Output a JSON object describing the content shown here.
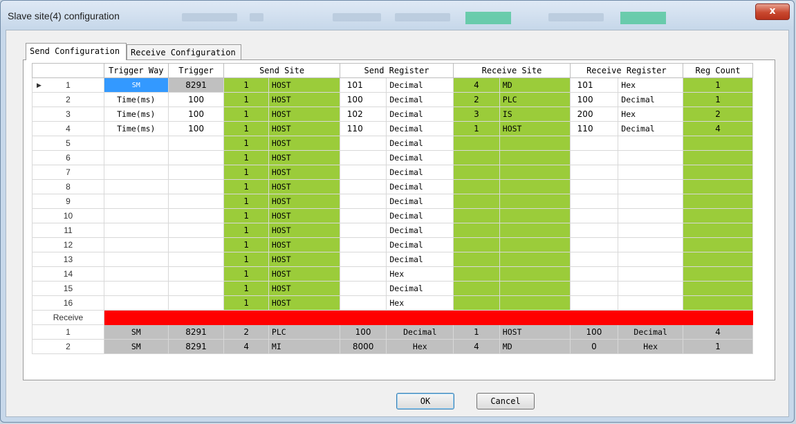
{
  "window": {
    "title": "Slave site(4) configuration",
    "close_glyph": "x"
  },
  "tabs": [
    "Send Configuration",
    "Receive Configuration"
  ],
  "columns": [
    "Trigger Way",
    "Trigger",
    "Send Site",
    "Send Register",
    "Receive Site",
    "Receive Register",
    "Reg Count"
  ],
  "send_rows": [
    {
      "n": "1",
      "way": "SM",
      "trig": "8291",
      "ss_num": "1",
      "ss_name": "HOST",
      "sr_val": "101",
      "sr_fmt": "Decimal",
      "rs_num": "4",
      "rs_name": "MD",
      "rr_val": "101",
      "rr_fmt": "Hex",
      "count": "1"
    },
    {
      "n": "2",
      "way": "Time(ms)",
      "trig": "100",
      "ss_num": "1",
      "ss_name": "HOST",
      "sr_val": "100",
      "sr_fmt": "Decimal",
      "rs_num": "2",
      "rs_name": "PLC",
      "rr_val": "100",
      "rr_fmt": "Decimal",
      "count": "1"
    },
    {
      "n": "3",
      "way": "Time(ms)",
      "trig": "100",
      "ss_num": "1",
      "ss_name": "HOST",
      "sr_val": "102",
      "sr_fmt": "Decimal",
      "rs_num": "3",
      "rs_name": "IS",
      "rr_val": "200",
      "rr_fmt": "Hex",
      "count": "2"
    },
    {
      "n": "4",
      "way": "Time(ms)",
      "trig": "100",
      "ss_num": "1",
      "ss_name": "HOST",
      "sr_val": "110",
      "sr_fmt": "Decimal",
      "rs_num": "1",
      "rs_name": "HOST",
      "rr_val": "110",
      "rr_fmt": "Decimal",
      "count": "4"
    },
    {
      "n": "5",
      "way": "",
      "trig": "",
      "ss_num": "1",
      "ss_name": "HOST",
      "sr_val": "",
      "sr_fmt": "Decimal",
      "rs_num": "",
      "rs_name": "",
      "rr_val": "",
      "rr_fmt": "",
      "count": ""
    },
    {
      "n": "6",
      "way": "",
      "trig": "",
      "ss_num": "1",
      "ss_name": "HOST",
      "sr_val": "",
      "sr_fmt": "Decimal",
      "rs_num": "",
      "rs_name": "",
      "rr_val": "",
      "rr_fmt": "",
      "count": ""
    },
    {
      "n": "7",
      "way": "",
      "trig": "",
      "ss_num": "1",
      "ss_name": "HOST",
      "sr_val": "",
      "sr_fmt": "Decimal",
      "rs_num": "",
      "rs_name": "",
      "rr_val": "",
      "rr_fmt": "",
      "count": ""
    },
    {
      "n": "8",
      "way": "",
      "trig": "",
      "ss_num": "1",
      "ss_name": "HOST",
      "sr_val": "",
      "sr_fmt": "Decimal",
      "rs_num": "",
      "rs_name": "",
      "rr_val": "",
      "rr_fmt": "",
      "count": ""
    },
    {
      "n": "9",
      "way": "",
      "trig": "",
      "ss_num": "1",
      "ss_name": "HOST",
      "sr_val": "",
      "sr_fmt": "Decimal",
      "rs_num": "",
      "rs_name": "",
      "rr_val": "",
      "rr_fmt": "",
      "count": ""
    },
    {
      "n": "10",
      "way": "",
      "trig": "",
      "ss_num": "1",
      "ss_name": "HOST",
      "sr_val": "",
      "sr_fmt": "Decimal",
      "rs_num": "",
      "rs_name": "",
      "rr_val": "",
      "rr_fmt": "",
      "count": ""
    },
    {
      "n": "11",
      "way": "",
      "trig": "",
      "ss_num": "1",
      "ss_name": "HOST",
      "sr_val": "",
      "sr_fmt": "Decimal",
      "rs_num": "",
      "rs_name": "",
      "rr_val": "",
      "rr_fmt": "",
      "count": ""
    },
    {
      "n": "12",
      "way": "",
      "trig": "",
      "ss_num": "1",
      "ss_name": "HOST",
      "sr_val": "",
      "sr_fmt": "Decimal",
      "rs_num": "",
      "rs_name": "",
      "rr_val": "",
      "rr_fmt": "",
      "count": ""
    },
    {
      "n": "13",
      "way": "",
      "trig": "",
      "ss_num": "1",
      "ss_name": "HOST",
      "sr_val": "",
      "sr_fmt": "Decimal",
      "rs_num": "",
      "rs_name": "",
      "rr_val": "",
      "rr_fmt": "",
      "count": ""
    },
    {
      "n": "14",
      "way": "",
      "trig": "",
      "ss_num": "1",
      "ss_name": "HOST",
      "sr_val": "",
      "sr_fmt": "Hex",
      "rs_num": "",
      "rs_name": "",
      "rr_val": "",
      "rr_fmt": "",
      "count": ""
    },
    {
      "n": "15",
      "way": "",
      "trig": "",
      "ss_num": "1",
      "ss_name": "HOST",
      "sr_val": "",
      "sr_fmt": "Decimal",
      "rs_num": "",
      "rs_name": "",
      "rr_val": "",
      "rr_fmt": "",
      "count": ""
    },
    {
      "n": "16",
      "way": "",
      "trig": "",
      "ss_num": "1",
      "ss_name": "HOST",
      "sr_val": "",
      "sr_fmt": "Hex",
      "rs_num": "",
      "rs_name": "",
      "rr_val": "",
      "rr_fmt": "",
      "count": ""
    }
  ],
  "receive_label": "Receive",
  "receive_rows": [
    {
      "n": "1",
      "way": "SM",
      "trig": "8291",
      "ss_num": "2",
      "ss_name": "PLC",
      "sr_val": "100",
      "sr_fmt": "Decimal",
      "rs_num": "1",
      "rs_name": "HOST",
      "rr_val": "100",
      "rr_fmt": "Decimal",
      "count": "4"
    },
    {
      "n": "2",
      "way": "SM",
      "trig": "8291",
      "ss_num": "4",
      "ss_name": "MI",
      "sr_val": "8000",
      "sr_fmt": "Hex",
      "rs_num": "4",
      "rs_name": "MD",
      "rr_val": "0",
      "rr_fmt": "Hex",
      "count": "1"
    }
  ],
  "buttons": {
    "ok": "OK",
    "cancel": "Cancel"
  },
  "colors": {
    "green": "#9bcc3a",
    "red": "#ff0000",
    "gray": "#c0c0c0",
    "selection": "#3399ff"
  },
  "icons": {
    "row_pointer": "row-pointer-icon",
    "close": "close-icon"
  }
}
